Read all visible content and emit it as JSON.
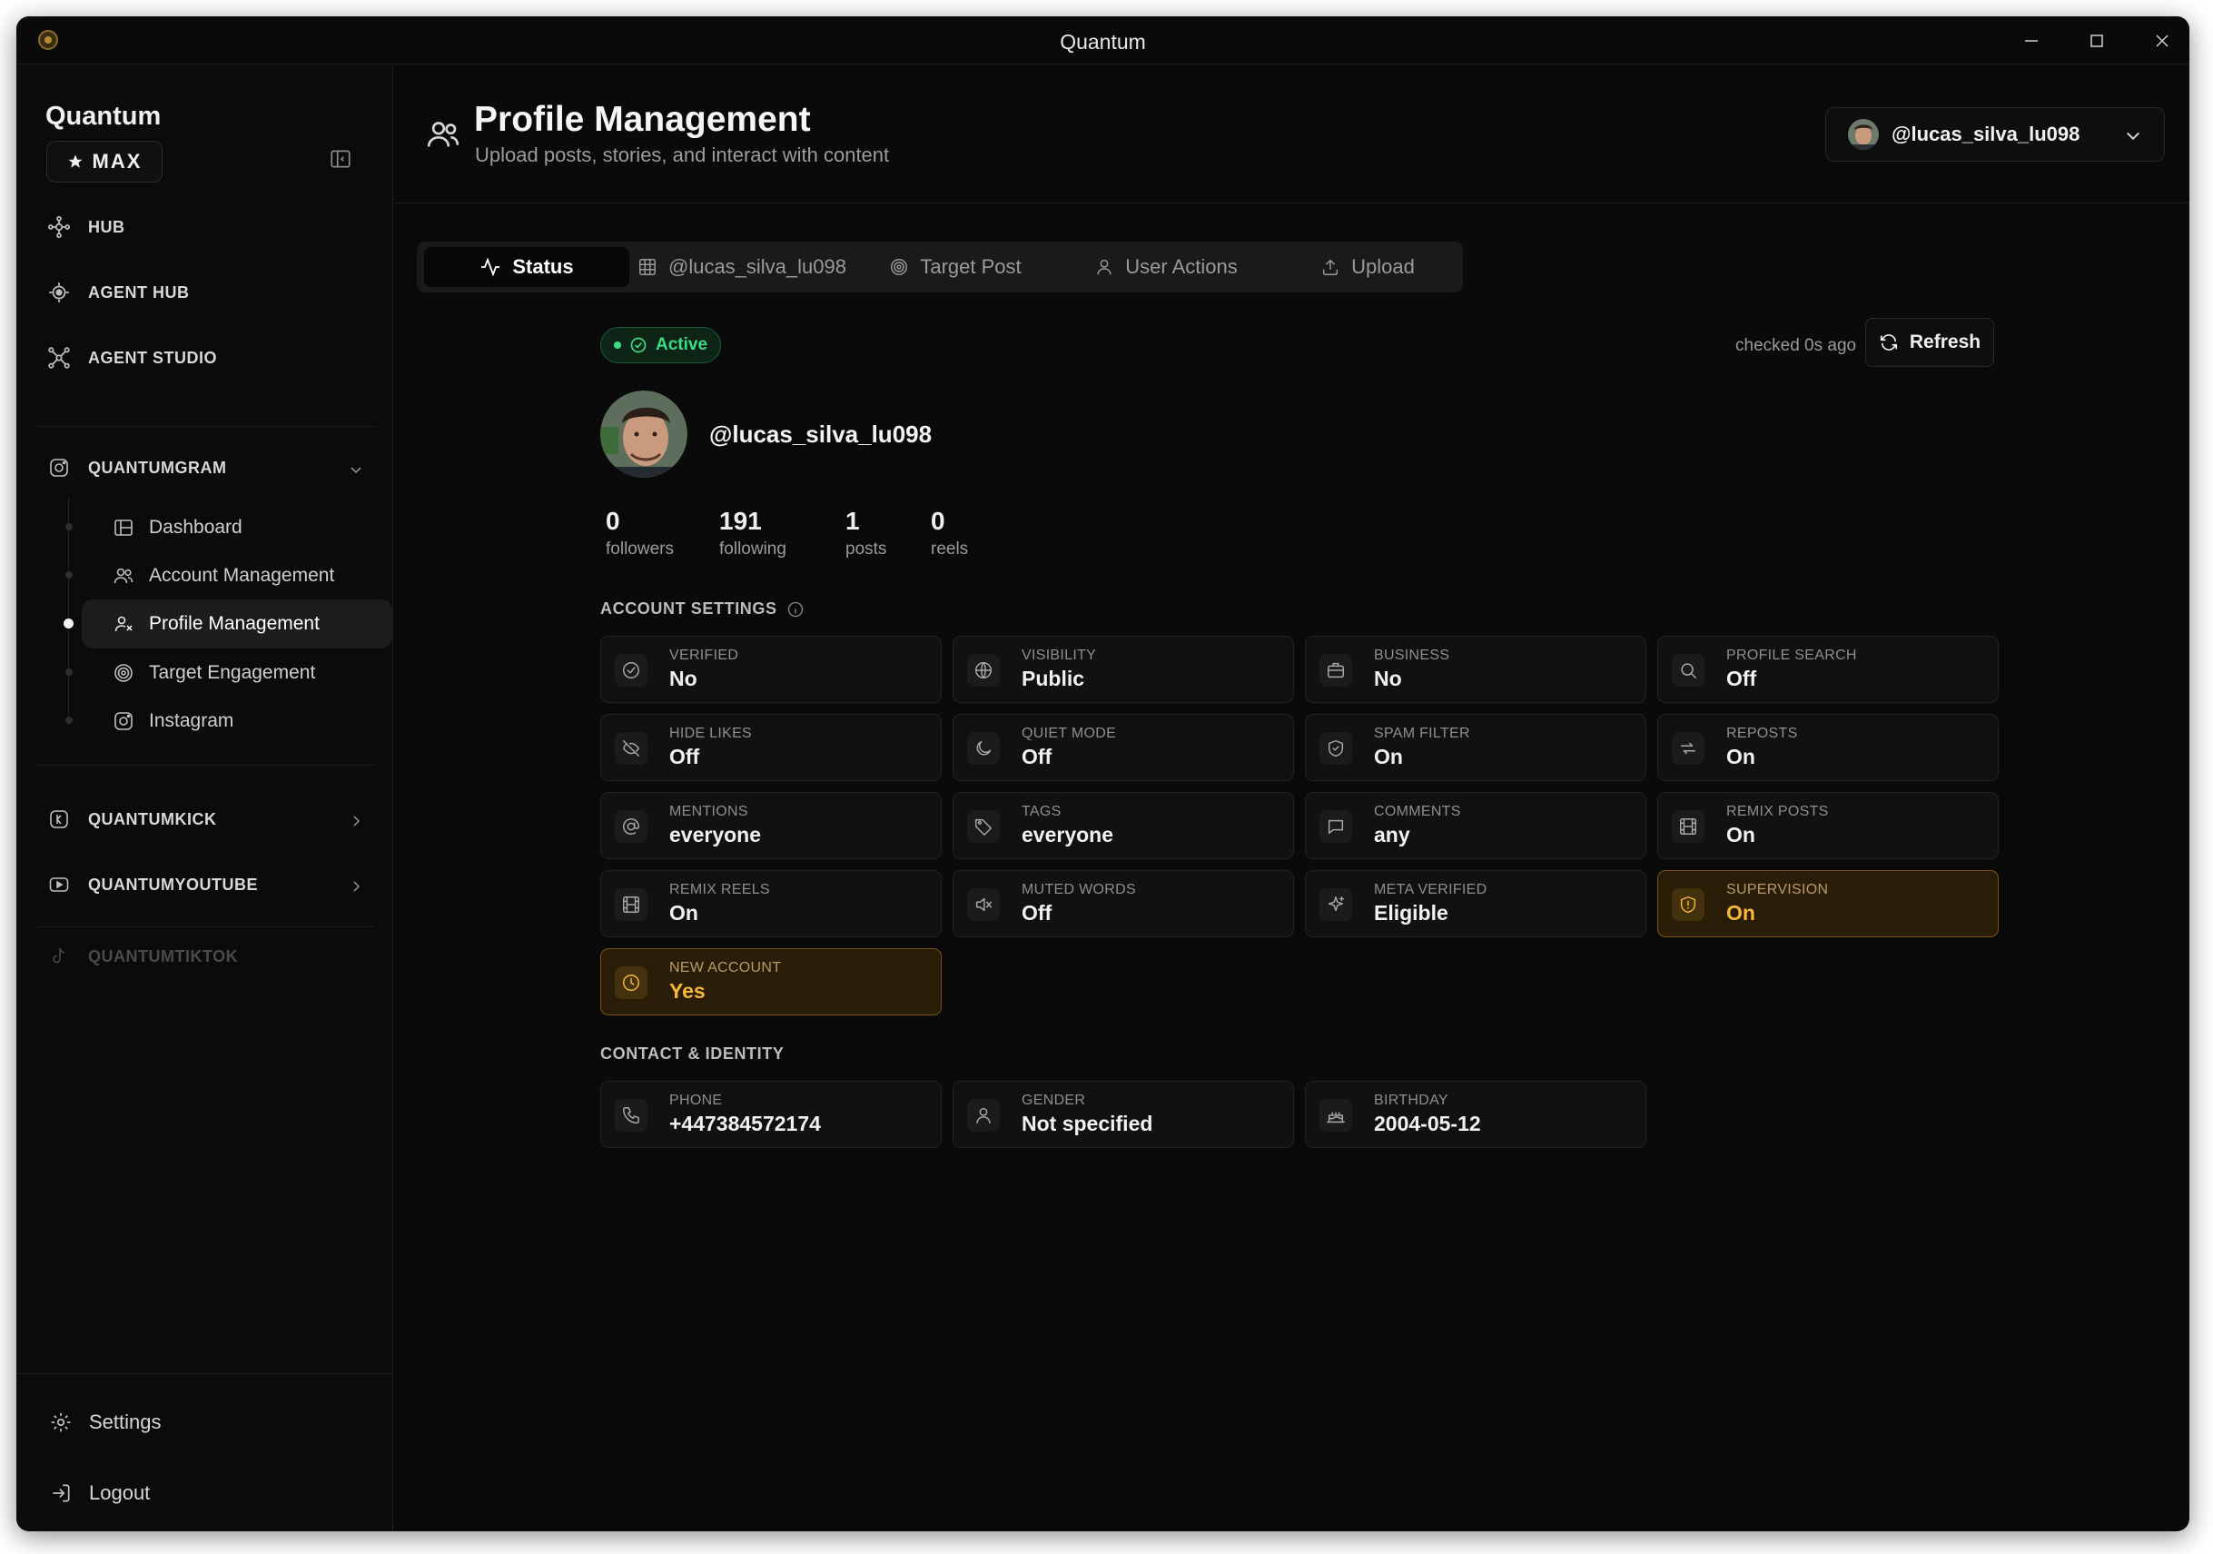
{
  "window": {
    "title": "Quantum"
  },
  "sidebar": {
    "brand": "Quantum",
    "badge": "MAX",
    "nav": [
      {
        "label": "HUB",
        "icon": "hub-icon"
      },
      {
        "label": "AGENT HUB",
        "icon": "agent-hub-icon"
      },
      {
        "label": "AGENT STUDIO",
        "icon": "agent-studio-icon"
      }
    ],
    "groups": [
      {
        "label": "QUANTUMGRAM",
        "icon": "instagram-icon",
        "expanded": true
      },
      {
        "label": "QUANTUMKICK",
        "icon": "kick-icon",
        "expanded": false
      },
      {
        "label": "QUANTUMYOUTUBE",
        "icon": "youtube-icon",
        "expanded": false
      },
      {
        "label": "QUANTUMTIKTOK",
        "icon": "tiktok-icon",
        "disabled": true
      }
    ],
    "subitems": [
      {
        "label": "Dashboard",
        "icon": "dashboard-icon"
      },
      {
        "label": "Account Management",
        "icon": "users-icon"
      },
      {
        "label": "Profile Management",
        "icon": "profile-icon",
        "active": true
      },
      {
        "label": "Target Engagement",
        "icon": "target-icon"
      },
      {
        "label": "Instagram",
        "icon": "instagram-icon"
      }
    ],
    "bottom": [
      {
        "label": "Settings",
        "icon": "gear-icon"
      },
      {
        "label": "Logout",
        "icon": "logout-icon"
      }
    ]
  },
  "header": {
    "title": "Profile Management",
    "subtitle": "Upload posts, stories, and interact with content",
    "account": "@lucas_silva_lu098"
  },
  "tabs": [
    {
      "label": "Status",
      "icon": "activity-icon",
      "active": true
    },
    {
      "label": "@lucas_silva_lu098",
      "icon": "grid-icon"
    },
    {
      "label": "Target Post",
      "icon": "target-icon"
    },
    {
      "label": "User Actions",
      "icon": "user-icon"
    },
    {
      "label": "Upload",
      "icon": "upload-icon"
    }
  ],
  "status": {
    "badge": "Active",
    "checked": "checked 0s ago",
    "refresh": "Refresh"
  },
  "profile": {
    "handle": "@lucas_silva_lu098",
    "stats": [
      {
        "value": "0",
        "label": "followers"
      },
      {
        "value": "191",
        "label": "following"
      },
      {
        "value": "1",
        "label": "posts"
      },
      {
        "value": "0",
        "label": "reels"
      }
    ]
  },
  "account_settings": {
    "title": "ACCOUNT SETTINGS",
    "items": [
      {
        "label": "VERIFIED",
        "value": "No",
        "icon": "check-circle-icon"
      },
      {
        "label": "VISIBILITY",
        "value": "Public",
        "icon": "globe-icon"
      },
      {
        "label": "BUSINESS",
        "value": "No",
        "icon": "briefcase-icon"
      },
      {
        "label": "PROFILE SEARCH",
        "value": "Off",
        "icon": "search-icon"
      },
      {
        "label": "HIDE LIKES",
        "value": "Off",
        "icon": "eye-off-icon"
      },
      {
        "label": "QUIET MODE",
        "value": "Off",
        "icon": "moon-icon"
      },
      {
        "label": "SPAM FILTER",
        "value": "On",
        "icon": "shield-icon"
      },
      {
        "label": "REPOSTS",
        "value": "On",
        "icon": "repost-icon"
      },
      {
        "label": "MENTIONS",
        "value": "everyone",
        "icon": "at-icon"
      },
      {
        "label": "TAGS",
        "value": "everyone",
        "icon": "tag-icon"
      },
      {
        "label": "COMMENTS",
        "value": "any",
        "icon": "comment-icon"
      },
      {
        "label": "REMIX POSTS",
        "value": "On",
        "icon": "film-icon"
      },
      {
        "label": "REMIX REELS",
        "value": "On",
        "icon": "film-icon"
      },
      {
        "label": "MUTED WORDS",
        "value": "Off",
        "icon": "mute-icon"
      },
      {
        "label": "META VERIFIED",
        "value": "Eligible",
        "icon": "sparkle-icon"
      },
      {
        "label": "SUPERVISION",
        "value": "On",
        "icon": "shield-alert-icon",
        "warn": true
      },
      {
        "label": "NEW ACCOUNT",
        "value": "Yes",
        "icon": "clock-icon",
        "warn": true
      }
    ]
  },
  "contact": {
    "title": "CONTACT & IDENTITY",
    "items": [
      {
        "label": "PHONE",
        "value": "+447384572174",
        "icon": "phone-icon"
      },
      {
        "label": "GENDER",
        "value": "Not specified",
        "icon": "user-icon"
      },
      {
        "label": "BIRTHDAY",
        "value": "2004-05-12",
        "icon": "cake-icon"
      }
    ]
  },
  "colors": {
    "background": "#0a0a0a",
    "accent_green": "#3ddc84",
    "warn_amber": "#f6b73c"
  }
}
